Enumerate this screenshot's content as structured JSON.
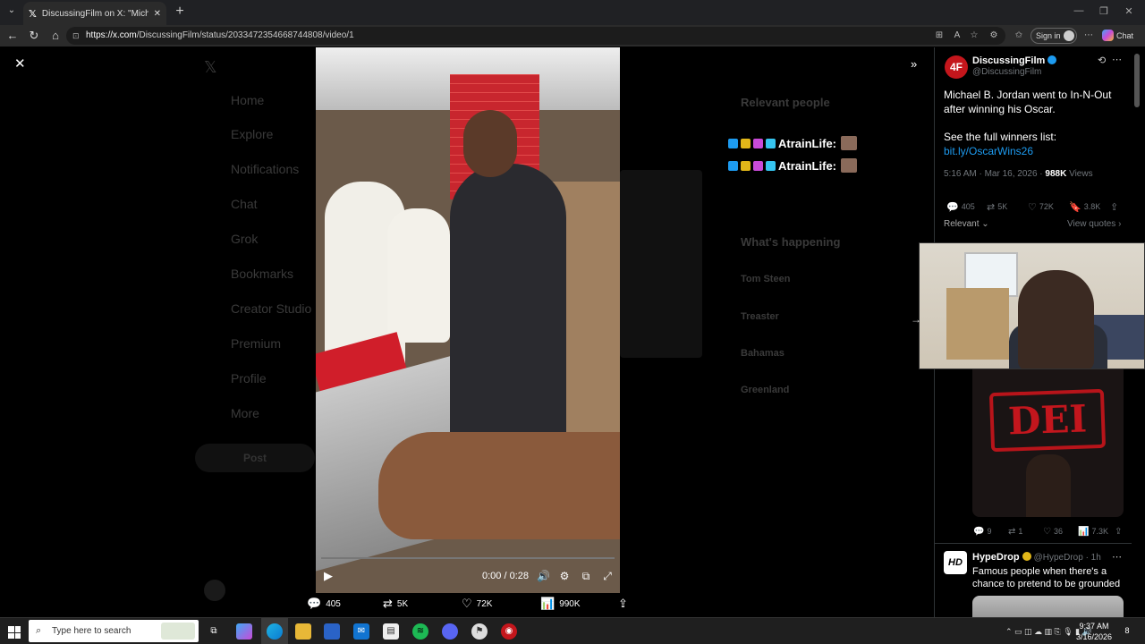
{
  "browser": {
    "tab_title": "DiscussingFilm on X: \"Michael B. Jo",
    "url_host": "https://x.com",
    "url_path": "/DiscussingFilm/status/2033472354668744808/video/1",
    "signin_label": "Sign in",
    "chat_label": "Chat"
  },
  "background": {
    "nav_items": [
      "Home",
      "Explore",
      "Notifications",
      "Chat",
      "Grok",
      "Bookmarks",
      "Creator Studio",
      "Premium",
      "Profile",
      "More"
    ],
    "post_button": "Post",
    "right_sections": {
      "relevant_people": "Relevant people",
      "whats_happening": "What's happening",
      "trends": [
        "Tom Steen",
        "Treaster",
        "Bahamas",
        "Greenland"
      ]
    }
  },
  "video": {
    "time": "0:00 / 0:28",
    "progress": 0,
    "actions": {
      "replies": "405",
      "reposts": "5K",
      "likes": "72K",
      "views": "990K"
    }
  },
  "overlay": {
    "line1": "AtrainLife:",
    "line2": "AtrainLife:"
  },
  "tweet": {
    "author_name": "DiscussingFilm",
    "author_handle": "@DiscussingFilm",
    "avatar_text": "4F",
    "text": "Michael B. Jordan went to In-N-Out after winning his Oscar.",
    "winners_text": "See the full winners list:",
    "link": "bit.ly/OscarWins26",
    "timestamp": "5:16 AM · Mar 16, 2026 · ",
    "views_count": "988K",
    "views_label": " Views",
    "stats": {
      "replies": "405",
      "reposts": "5K",
      "likes": "72K",
      "bookmarks": "3.8K"
    },
    "relevant_label": "Relevant",
    "view_quotes": "View quotes"
  },
  "reply": {
    "thumbnail_text": "DEI",
    "stats": {
      "replies": "9",
      "reposts": "1",
      "likes": "36",
      "views": "7.3K"
    }
  },
  "second_tweet": {
    "avatar_text": "HD",
    "author_name": "HypeDrop",
    "author_meta": "@HypeDrop · 1h",
    "text": "Famous people when there's a chance to pretend to be grounded"
  },
  "taskbar": {
    "search_placeholder": "Type here to search",
    "time": "9:37 AM",
    "date": "3/16/2026",
    "notification_count": "8"
  },
  "colors": {
    "accent": "#1d9bf0",
    "background": "#000000",
    "dei_red": "#c3161d"
  }
}
